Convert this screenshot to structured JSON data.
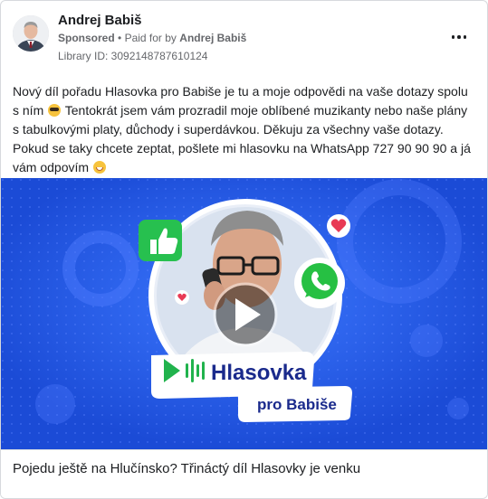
{
  "post": {
    "page_name": "Andrej Babiš",
    "sponsored_label": "Sponsored",
    "separator": "•",
    "paid_for_prefix": "Paid for by",
    "paid_for_name": "Andrej Babiš",
    "library_id": "Library ID: 3092148787610124",
    "body_line_1": "Nový díl pořadu Hlasovka pro Babiše je tu a moje odpovědi na vaše dotazy spolu s ním",
    "body_line_2": "Tentokrát jsem vám prozradil moje oblíbené muzikanty nebo naše plány s tabulkovými platy, důchody i superdávkou. Děkuju za všechny vaše dotazy. Pokud se taky chcete zeptat, pošlete mi hlasovku na WhatsApp 727 90 90 90 a já vám odpovím",
    "emoji_1": "smiling-face-with-sunglasses",
    "emoji_2": "grinning-face"
  },
  "media": {
    "kind": "video-thumbnail",
    "banner_title": "Hlasovka",
    "banner_subtitle": "pro Babiše",
    "background_color": "#1e52e3",
    "accent_color": "#2bbf5a"
  },
  "caption": {
    "text": "Pojedu ještě na Hlučínsko? Třináctý díl Hlasovky je venku"
  }
}
